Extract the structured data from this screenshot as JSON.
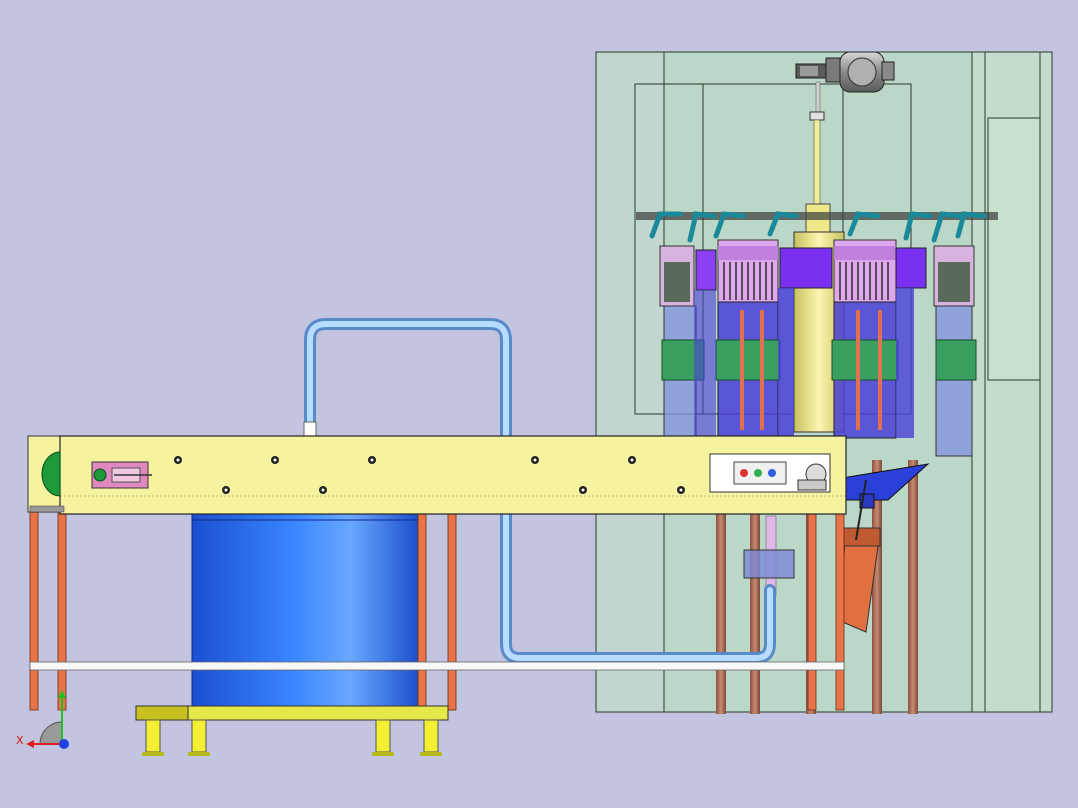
{
  "viewport": {
    "background": "#c3c4df",
    "axis_triad": {
      "x_label": "X",
      "y_label": "",
      "z_label": ""
    }
  },
  "colors": {
    "frame_glass": "#bcdcc8",
    "conveyor_yellow": "#f6f3a0",
    "tank_blue": "#2a6cf0",
    "pipe_blue": "#9ac8f0",
    "leg_orange": "#e8744a",
    "module_purple": "#7a3cf0",
    "module_pink": "#d88ce6",
    "module_green": "#3aa060",
    "column_yellow": "#eee88a",
    "pallet_yellow": "#e6e84a",
    "status_lights": [
      "#e03030",
      "#30b050",
      "#3060e0"
    ]
  },
  "components": [
    "motor-assembly",
    "main-column",
    "rotary-filler-carousel",
    "conveyor-belt",
    "drive-roller",
    "control-box",
    "operator-panel",
    "storage-tank",
    "connecting-pipe",
    "pallet-base",
    "support-legs",
    "discharge-chute"
  ]
}
